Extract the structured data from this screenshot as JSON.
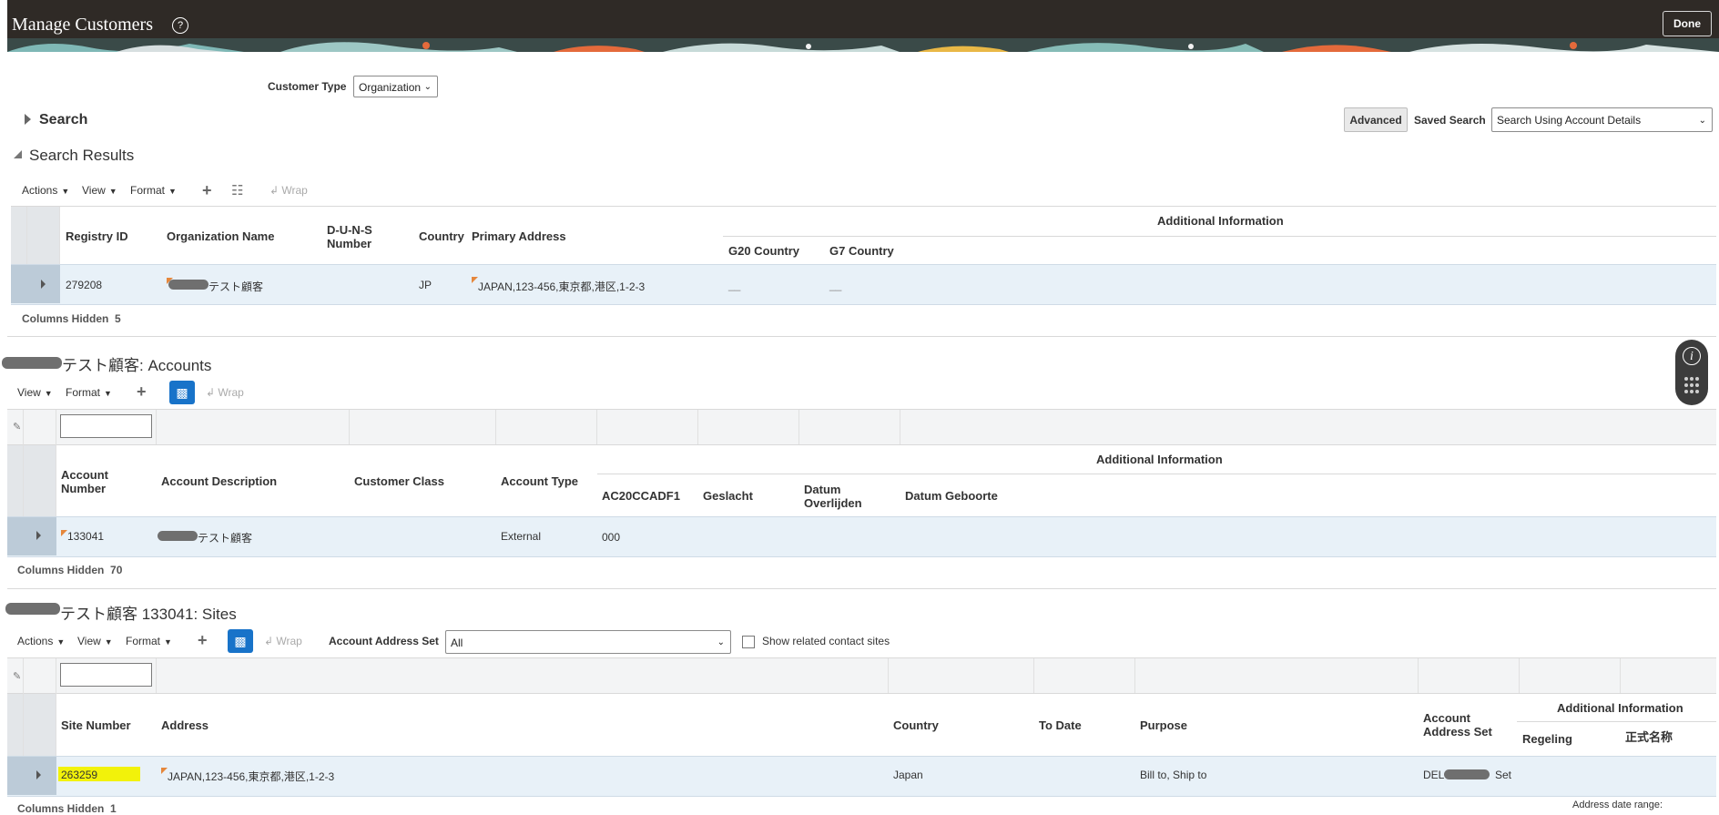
{
  "header": {
    "title": "Manage Customers",
    "help_icon": "?",
    "done_label": "Done"
  },
  "customer_type": {
    "label": "Customer Type",
    "value": "Organization"
  },
  "search": {
    "label": "Search",
    "advanced_label": "Advanced",
    "saved_search_label": "Saved Search",
    "saved_search_value": "Search Using Account Details"
  },
  "results": {
    "heading": "Search Results",
    "toolbar": {
      "actions": "Actions",
      "view": "View",
      "format": "Format",
      "wrap": "Wrap"
    },
    "additional_info": "Additional Information",
    "columns": {
      "registry_id": "Registry ID",
      "org_name": "Organization Name",
      "duns": "D-U-N-S Number",
      "country": "Country",
      "primary_address": "Primary Address",
      "g20": "G20 Country",
      "g7": "G7 Country"
    },
    "row": {
      "registry_id": "279208",
      "org_name": "テスト顧客",
      "country": "JP",
      "primary_address": "JAPAN,123-456,東京都,港区,1-2-3",
      "g20": "__",
      "g7": "__"
    },
    "columns_hidden_label": "Columns Hidden",
    "columns_hidden_value": "5"
  },
  "accounts": {
    "heading": "テスト顧客: Accounts",
    "toolbar": {
      "view": "View",
      "format": "Format",
      "wrap": "Wrap"
    },
    "additional_info": "Additional Information",
    "columns": {
      "account_number": "Account Number",
      "account_description": "Account Description",
      "customer_class": "Customer Class",
      "account_type": "Account Type",
      "ac20": "AC20CCADF1",
      "geslacht": "Geslacht",
      "datum_overlijden": "Datum Overlijden",
      "datum_geboorte": "Datum Geboorte"
    },
    "row": {
      "account_number": "133041",
      "account_description": "テスト顧客",
      "account_type": "External",
      "ac20": "000"
    },
    "columns_hidden_label": "Columns Hidden",
    "columns_hidden_value": "70"
  },
  "sites": {
    "heading": "テスト顧客 133041: Sites",
    "toolbar": {
      "actions": "Actions",
      "view": "View",
      "format": "Format",
      "wrap": "Wrap"
    },
    "address_set_label": "Account Address Set",
    "address_set_value": "All",
    "show_related_label": "Show related contact sites",
    "additional_info": "Additional Information",
    "columns": {
      "site_number": "Site Number",
      "address": "Address",
      "country": "Country",
      "to_date": "To Date",
      "purpose": "Purpose",
      "account_address_set": "Account Address Set",
      "regeling": "Regeling",
      "seishiki": "正式名称"
    },
    "row": {
      "site_number": "263259",
      "address": "JAPAN,123-456,東京都,港区,1-2-3",
      "country": "Japan",
      "purpose": "Bill to, Ship to",
      "address_set_a": "DEL",
      "address_set_b": "Set"
    },
    "columns_hidden_label": "Columns Hidden",
    "columns_hidden_value": "1",
    "address_date_range": "Address date range:"
  },
  "colors": {
    "header_bg": "#2f2a26",
    "link": "#1e6a96",
    "row_selected": "#e8f1f8",
    "highlight": "#f2f20a",
    "toolbar_blue": "#1873c9"
  }
}
